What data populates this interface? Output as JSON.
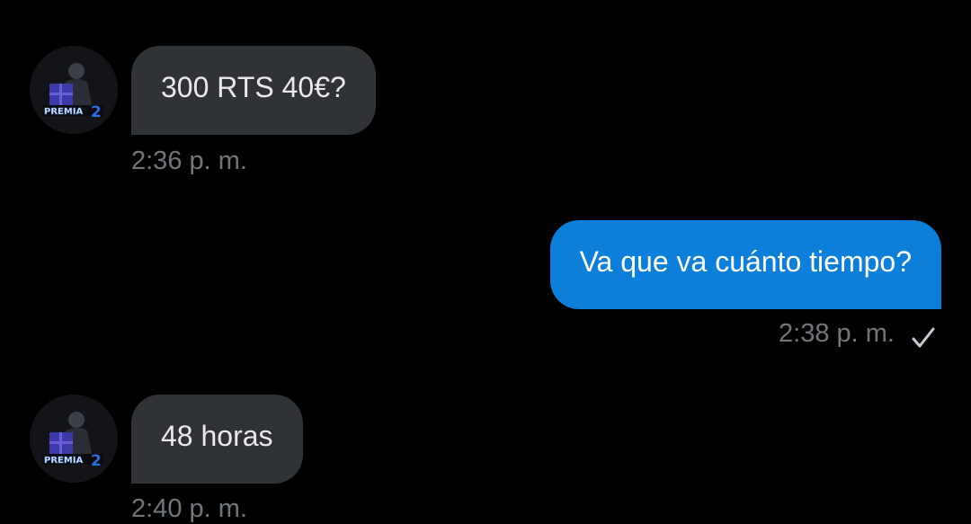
{
  "colors": {
    "background": "#000000",
    "incoming_bubble": "#2f3336",
    "outgoing_bubble": "#0b7fd9",
    "timestamp": "#71767b"
  },
  "conversation": {
    "messages": [
      {
        "direction": "incoming",
        "text": "300 RTS 40€?",
        "time": "2:36 p. m.",
        "avatar_label": "PREMIA2"
      },
      {
        "direction": "outgoing",
        "text": "Va que va cuánto tiempo?",
        "time": "2:38 p. m.",
        "status_icon": "checkmark-icon"
      },
      {
        "direction": "incoming",
        "text": "48 horas",
        "time": "2:40 p. m.",
        "avatar_label": "PREMIA2"
      }
    ]
  }
}
